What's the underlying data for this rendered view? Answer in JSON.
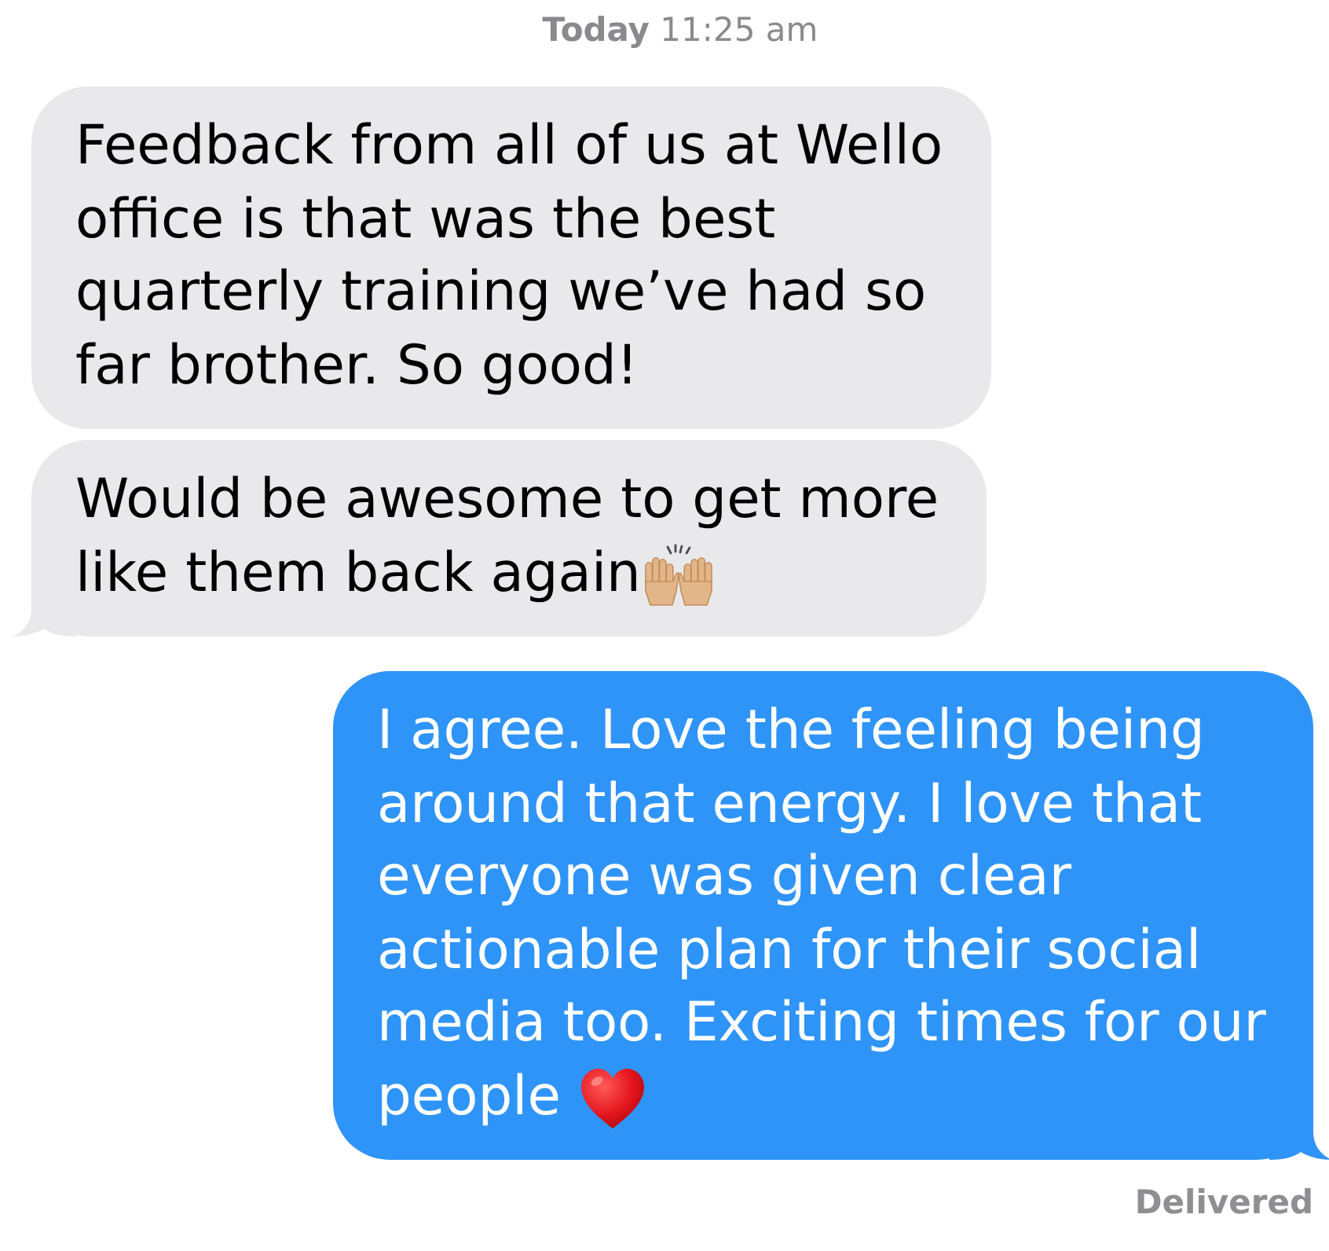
{
  "timestamp": "**Today** 11:25 am",
  "messages": [
    {
      "kind": "received",
      "text": "Feedback from all of us at Wello office is that was the best quarterly training we’ve had so far brother. So good!",
      "tail": false
    },
    {
      "kind": "received",
      "text": "Would be awesome to get more like them back again",
      "emoji": {
        "kind": "raised_hands"
      },
      "tail": true
    },
    {
      "kind": "sent",
      "text": "I agree. Love the feeling being around that energy. I love that everyone was given clear actionable plan for their social media too. Exciting times for our people",
      "emoji": {
        "kind": "red_heart"
      },
      "tail": true
    }
  ],
  "status": "Delivered"
}
